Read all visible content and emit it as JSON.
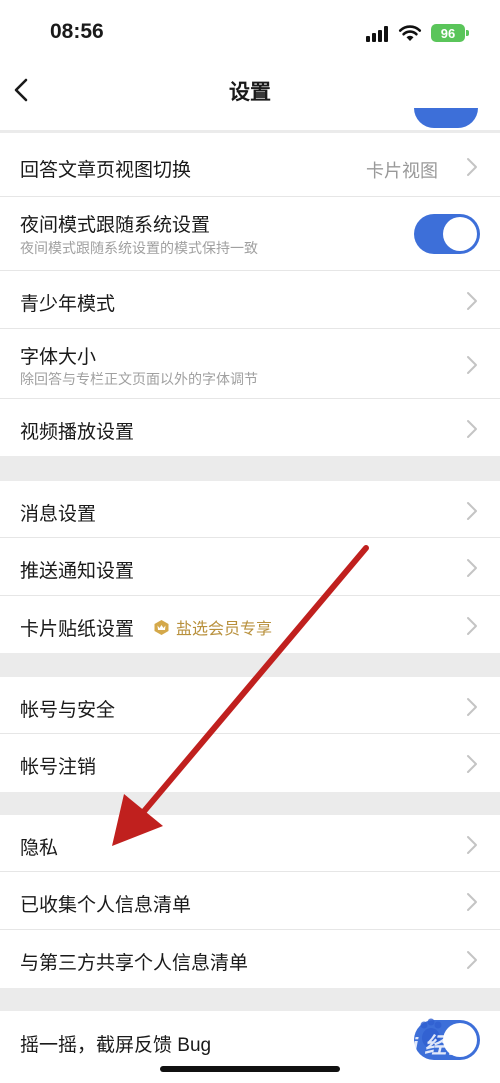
{
  "status": {
    "time": "08:56",
    "battery": "96"
  },
  "nav": {
    "title": "设置"
  },
  "sections": [
    {
      "rows": [
        {
          "label": "回答文章页视图切换",
          "value": "卡片视图"
        },
        {
          "label": "夜间模式跟随系统设置",
          "sub": "夜间模式跟随系统设置的模式保持一致",
          "toggle": true
        },
        {
          "label": "青少年模式"
        },
        {
          "label": "字体大小",
          "sub": "除回答与专栏正文页面以外的字体调节"
        },
        {
          "label": "视频播放设置"
        }
      ]
    },
    {
      "rows": [
        {
          "label": "消息设置"
        },
        {
          "label": "推送通知设置"
        },
        {
          "label": "卡片贴纸设置",
          "badge": "盐选会员专享"
        }
      ]
    },
    {
      "rows": [
        {
          "label": "帐号与安全"
        },
        {
          "label": "帐号注销"
        }
      ]
    },
    {
      "rows": [
        {
          "label": "隐私"
        },
        {
          "label": "已收集个人信息清单"
        },
        {
          "label": "与第三方共享个人信息清单"
        }
      ]
    },
    {
      "rows": [
        {
          "label": "摇一摇，截屏反馈 Bug",
          "toggle": true
        }
      ]
    }
  ],
  "colors": {
    "accent": "#3d6fd9",
    "annotation_arrow": "#c0201e",
    "badge": "#b8903c"
  },
  "watermark": "Bai 经验"
}
